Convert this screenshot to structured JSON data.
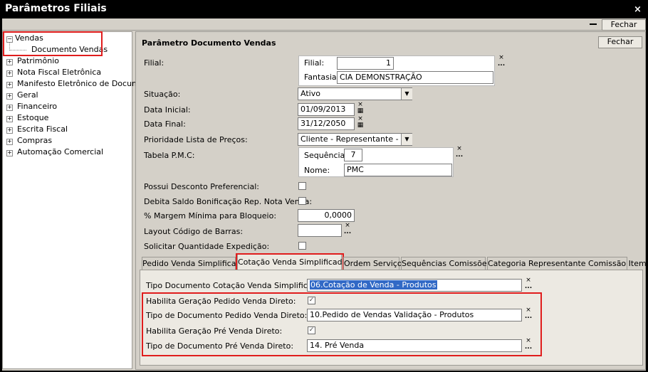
{
  "window": {
    "title": "Parâmetros Filiais",
    "close_icon": "×",
    "fechar_label": "Fechar"
  },
  "tree": {
    "vendas": {
      "label": "Vendas",
      "child": "Documento Vendas"
    },
    "items": [
      "Patrimônio",
      "Nota Fiscal Eletrônica",
      "Manifesto Eletrônico de Documento",
      "Geral",
      "Financeiro",
      "Estoque",
      "Escrita Fiscal",
      "Compras",
      "Automação Comercial"
    ]
  },
  "panel": {
    "title": "Parâmetro Documento Vendas",
    "fechar_label": "Fechar",
    "filial": {
      "label": "Filial:",
      "sub_label": "Filial:",
      "value": "1",
      "fantasia_label": "Fantasia:",
      "fantasia_value": "CIA DEMONSTRAÇÃO"
    },
    "situacao": {
      "label": "Situação:",
      "value": "Ativo"
    },
    "data_inicial": {
      "label": "Data Inicial:",
      "value": "01/09/2013"
    },
    "data_final": {
      "label": "Data Final:",
      "value": "31/12/2050"
    },
    "prioridade": {
      "label": "Prioridade Lista de Preços:",
      "value": "Cliente - Representante - Filial"
    },
    "tabela_pmc": {
      "label": "Tabela P.M.C:",
      "sequencia_label": "Sequência:",
      "sequencia_value": "7",
      "nome_label": "Nome:",
      "nome_value": "PMC"
    },
    "desconto": {
      "label": "Possui Desconto Preferencial:",
      "checked": false
    },
    "debita": {
      "label": "Debita Saldo Bonificação Rep. Nota Venda:",
      "checked": false
    },
    "margem": {
      "label": "% Margem Mínima para Bloqueio:",
      "value": "0,0000"
    },
    "layout_codigo": {
      "label": "Layout Código de Barras:",
      "value": ""
    },
    "solicitar": {
      "label": "Solicitar Quantidade Expedição:",
      "checked": false
    }
  },
  "tabs": [
    "Pedido Venda Simplificado",
    "Cotação Venda Simplificada",
    "Ordem Serviço",
    "Sequências Comissões",
    "Categoria Representante Comissão Item"
  ],
  "active_tab": 1,
  "cotacao": {
    "tipo_doc_label": "Tipo Documento Cotação Venda Simplificada:",
    "tipo_doc_value": "06.Cotação de Venda - Produtos",
    "hab_pedido_label": "Habilita Geração Pedido Venda Direto:",
    "hab_pedido_checked": true,
    "tipo_pedido_label": "Tipo de Documento Pedido Venda Direto:",
    "tipo_pedido_value": "10.Pedido de Vendas Validação - Produtos",
    "hab_pre_label": "Habilita Geração Pré Venda Direto:",
    "hab_pre_checked": true,
    "tipo_pre_label": "Tipo de Documento Pré Venda Direto:",
    "tipo_pre_value": "14. Pré Venda"
  },
  "glyphs": {
    "expand": "+",
    "collapse": "−",
    "check": "✓",
    "dropdown": "▼",
    "clear": "×",
    "lookup": "...",
    "calendar": "▦",
    "minimize": "—"
  },
  "colors": {
    "highlight_red": "#e01d1d",
    "selection_blue": "#3169c6",
    "chrome": "#d4d0c8"
  }
}
